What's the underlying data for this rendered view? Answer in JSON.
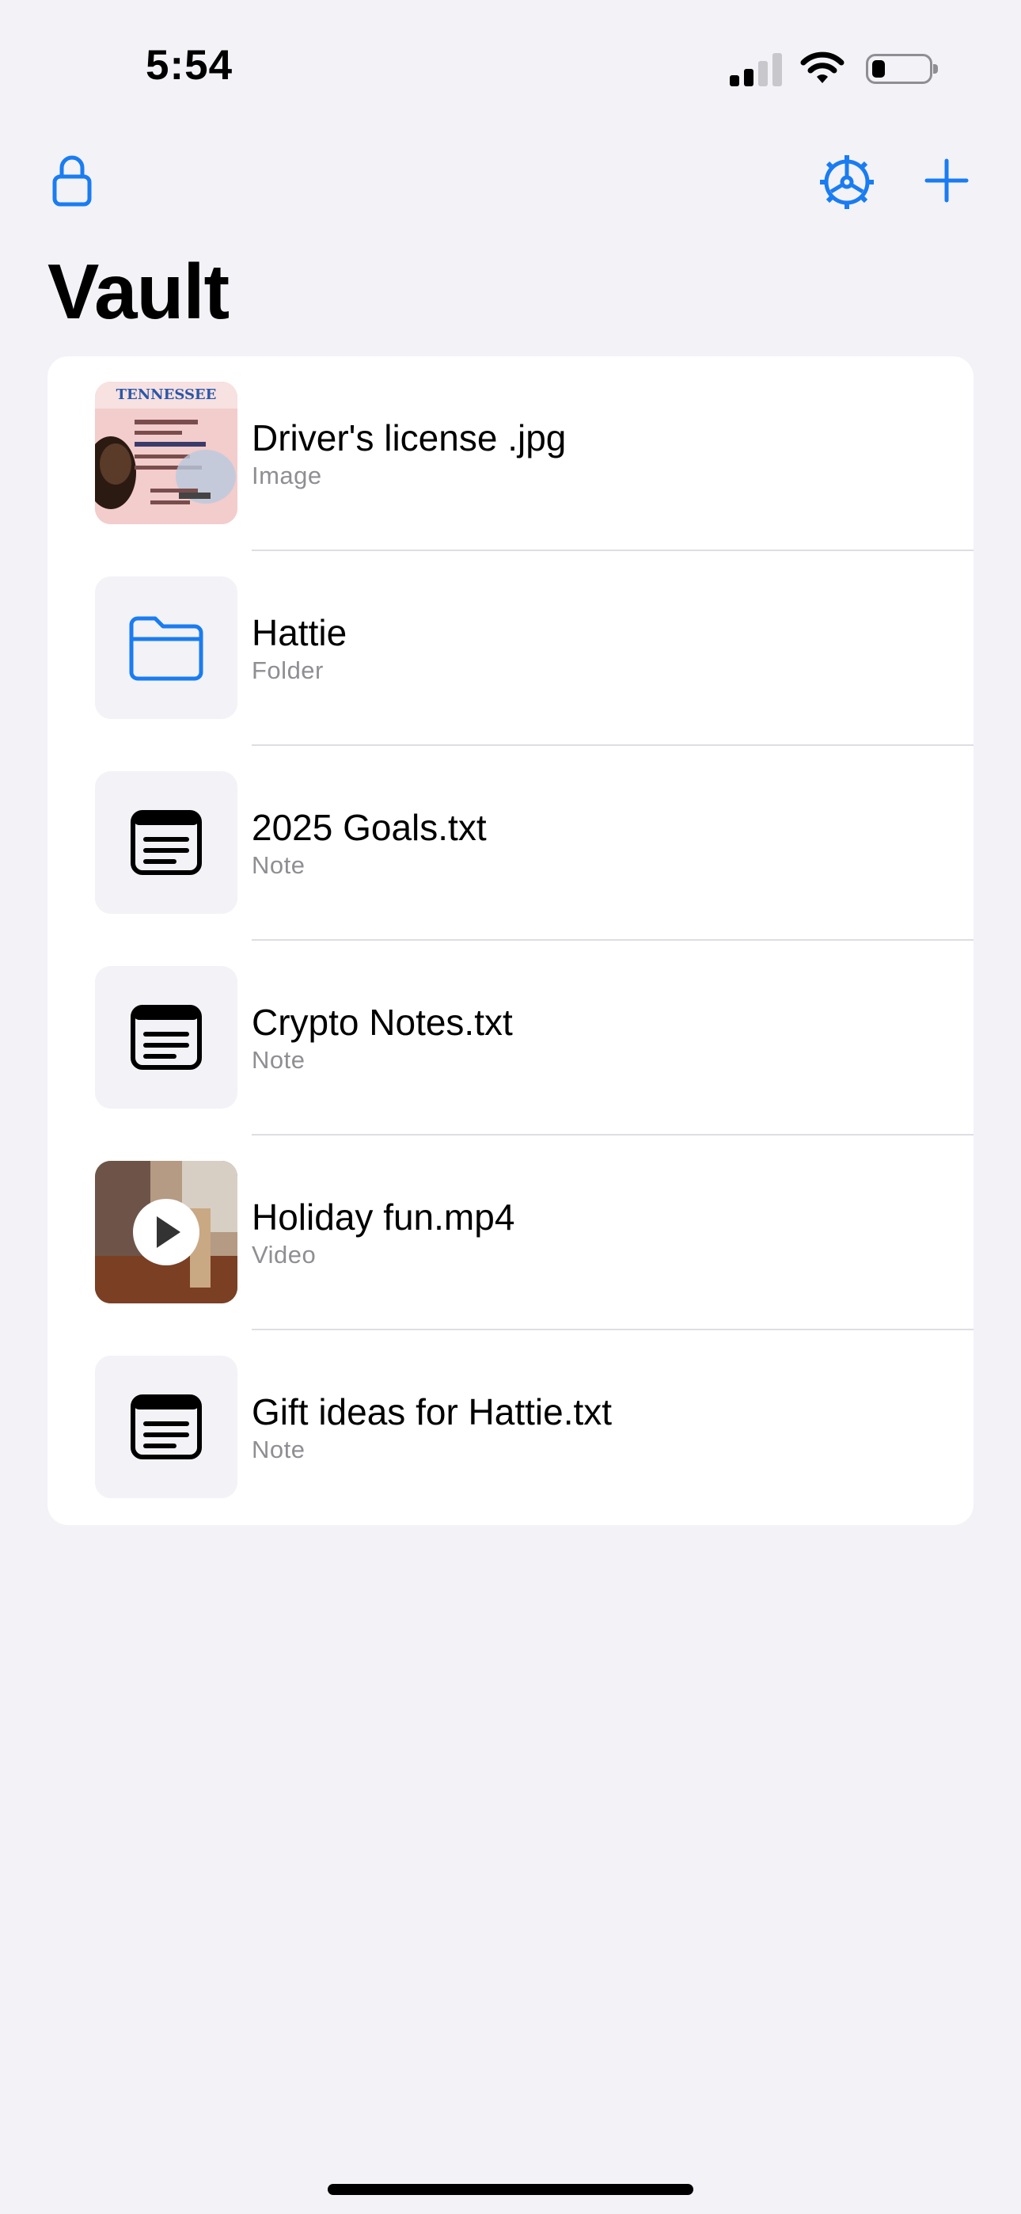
{
  "status_bar": {
    "time": "5:54",
    "icons": [
      "cellular-signal-icon",
      "wifi-icon",
      "battery-icon"
    ]
  },
  "nav": {
    "lock_icon": "lock-icon",
    "settings_icon": "gear-icon",
    "add_icon": "plus-icon"
  },
  "page": {
    "title": "Vault"
  },
  "colors": {
    "accent": "#1a7cf0",
    "background": "#f2f2f7",
    "card": "#ffffff",
    "secondary_text": "#8e8e93"
  },
  "items": [
    {
      "title": "Driver's license .jpg",
      "type": "Image",
      "icon": "license-photo-thumbnail"
    },
    {
      "title": "Hattie",
      "type": "Folder",
      "icon": "folder-icon"
    },
    {
      "title": "2025 Goals.txt",
      "type": "Note",
      "icon": "note-icon"
    },
    {
      "title": "Crypto Notes.txt",
      "type": "Note",
      "icon": "note-icon"
    },
    {
      "title": "Holiday fun.mp4",
      "type": "Video",
      "icon": "video-thumbnail"
    },
    {
      "title": "Gift ideas for Hattie.txt",
      "type": "Note",
      "icon": "note-icon"
    }
  ]
}
